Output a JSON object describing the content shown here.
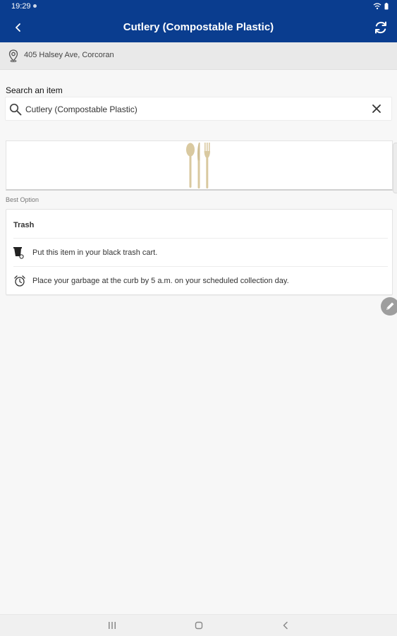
{
  "status_bar": {
    "time": "19:29"
  },
  "header": {
    "title": "Cutlery (Compostable Plastic)",
    "back_icon": "chevron-left-icon",
    "refresh_icon": "refresh-icon",
    "background_color": "#0a3d8f"
  },
  "location": {
    "address": "405 Halsey Ave, Corcoran",
    "icon": "location-pin-icon"
  },
  "search": {
    "label": "Search an item",
    "value": "Cutlery (Compostable Plastic)",
    "icon": "search-icon",
    "clear_icon": "close-icon"
  },
  "item_image": {
    "icon": "cutlery-icon"
  },
  "best_option": {
    "section_label": "Best Option",
    "title": "Trash",
    "rows": [
      {
        "icon": "trash-cart-icon",
        "text": "Put this item in your black trash cart."
      },
      {
        "icon": "alarm-clock-icon",
        "text": "Place your garbage at the curb by 5 a.m. on your scheduled collection day."
      }
    ]
  },
  "edit_fab": {
    "icon": "pencil-icon"
  },
  "nav_bar": {
    "icons": [
      "recent-apps-icon",
      "home-icon",
      "back-icon"
    ]
  }
}
